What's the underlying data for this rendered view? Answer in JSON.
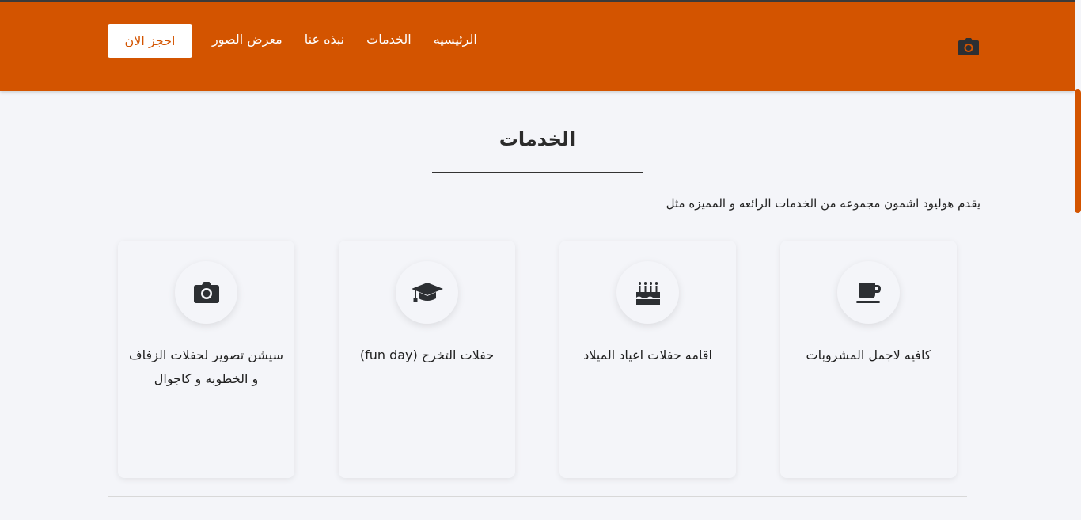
{
  "header": {
    "logo_icon": "camera-icon",
    "nav": [
      {
        "label": "معرض الصور"
      },
      {
        "label": "نبذه عنا"
      },
      {
        "label": "الخدمات"
      },
      {
        "label": "الرئيسيه"
      }
    ],
    "book_button": "احجز الان"
  },
  "services": {
    "title": "الخدمات",
    "intro": "يقدم هوليود اشمون مجموعه من الخدمات الرائعه و المميزه مثل",
    "cards": [
      {
        "icon": "camera-icon",
        "text": "سيشن تصوير لحفلات الزفاف و الخطوبه و كاجوال"
      },
      {
        "icon": "graduation-cap-icon",
        "text": "حفلات التخرج (fun day)"
      },
      {
        "icon": "birthday-cake-icon",
        "text": "اقامه حفلات اعياد الميلاد"
      },
      {
        "icon": "coffee-cup-icon",
        "text": "كافيه لاجمل المشروبات"
      }
    ]
  },
  "colors": {
    "accent": "#d35400",
    "background": "#f4f5f9",
    "icon": "#2c2f33"
  }
}
